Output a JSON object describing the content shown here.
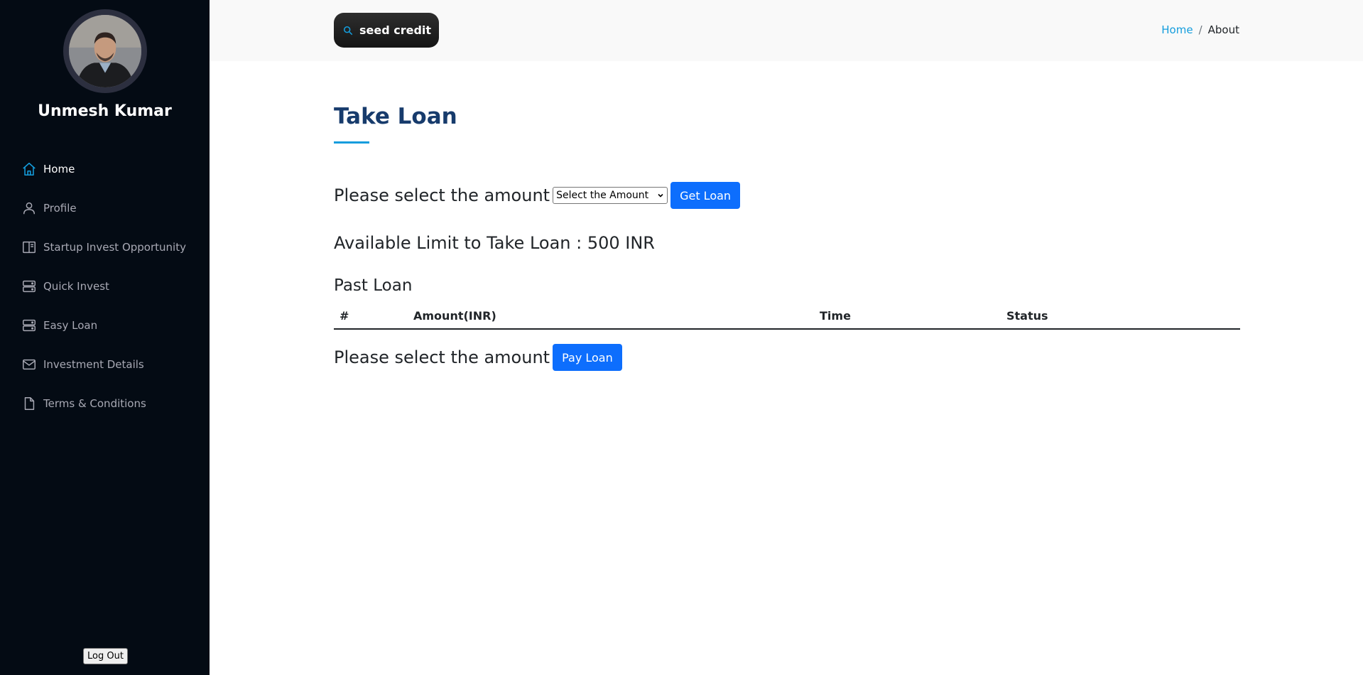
{
  "sidebar": {
    "user_name": "Unmesh Kumar",
    "items": [
      {
        "label": "Home",
        "icon": "house-icon",
        "active": true
      },
      {
        "label": "Profile",
        "icon": "person-icon",
        "active": false
      },
      {
        "label": "Startup Invest Opportunity",
        "icon": "book-icon",
        "active": false
      },
      {
        "label": "Quick Invest",
        "icon": "server-icon",
        "active": false
      },
      {
        "label": "Easy Loan",
        "icon": "server-icon",
        "active": false
      },
      {
        "label": "Investment Details",
        "icon": "envelope-icon",
        "active": false
      },
      {
        "label": "Terms & Conditions",
        "icon": "file-icon",
        "active": false
      }
    ],
    "logout_label": "Log Out"
  },
  "header": {
    "brand": "seed credit",
    "breadcrumb": {
      "home": "Home",
      "separator": "/",
      "current": "About"
    }
  },
  "main": {
    "title": "Take Loan",
    "take_prompt": "Please select the amount",
    "amount_select": {
      "selected": "Select the Amount"
    },
    "get_loan_label": "Get Loan",
    "limit_text": "Available Limit to Take Loan : 500 INR",
    "past_title": "Past Loan",
    "table_headers": [
      "#",
      "Amount(INR)",
      "Time",
      "Status"
    ],
    "pay_prompt": "Please select the amount",
    "pay_loan_label": "Pay Loan"
  },
  "colors": {
    "sidebar_bg": "#040b14",
    "accent": "#149ddd",
    "title": "#173b6c",
    "button": "#0d6efd"
  }
}
